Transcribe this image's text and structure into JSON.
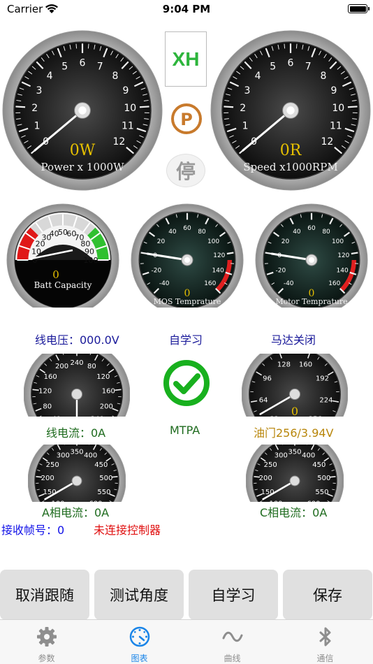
{
  "status_bar": {
    "carrier": "Carrier",
    "time": "9:04 PM"
  },
  "top_row": {
    "power_gauge": {
      "readout": "0W",
      "label": "Power x 1000W",
      "ticks": [
        "0",
        "1",
        "2",
        "3",
        "4",
        "5",
        "6",
        "7",
        "8",
        "9",
        "10",
        "11",
        "12"
      ],
      "value": 0
    },
    "speed_gauge": {
      "readout": "0R",
      "label": "Speed x1000RPM",
      "ticks": [
        "0",
        "1",
        "2",
        "3",
        "4",
        "5",
        "6",
        "7",
        "8",
        "9",
        "10",
        "11",
        "12"
      ],
      "value": 0
    },
    "xh_badge": "XH",
    "park_icon": "P",
    "stop_button": "停"
  },
  "middle_row": {
    "battery_gauge": {
      "readout": "0",
      "label": "Batt Capacity",
      "ticks": [
        "0",
        "10",
        "20",
        "30",
        "40",
        "50",
        "60",
        "70",
        "80",
        "90",
        "100"
      ],
      "value": 0
    },
    "mos_temp_gauge": {
      "readout": "0",
      "unit_glyph": "",
      "label": "MOS Temprature",
      "ticks": [
        "-40",
        "-20",
        "0",
        "20",
        "40",
        "60",
        "80",
        "100",
        "120",
        "140",
        "160"
      ],
      "value": 0
    },
    "motor_temp_gauge": {
      "readout": "0",
      "unit_glyph": "",
      "label": "Motor Temprature",
      "ticks": [
        "-40",
        "-20",
        "0",
        "20",
        "40",
        "60",
        "80",
        "100",
        "120",
        "140",
        "160"
      ],
      "value": 0
    }
  },
  "info": {
    "line_voltage": "线电压：000.0V",
    "self_learn_status": "自学习",
    "motor_status": "马达关闭",
    "line_current": "线电流：0A",
    "mode": "MTPA",
    "throttle": "油门256/3.94V",
    "phase_a_current": "A相电流：0A",
    "phase_c_current": "C相电流：0A",
    "frame_count": "接收帧号：0",
    "connection_status": "未连接控制器"
  },
  "small_gauges": {
    "line_current_ticks": [
      "40",
      "80",
      "120",
      "160",
      "200",
      "240",
      "80",
      "120",
      "160",
      "200",
      "240"
    ],
    "throttle_ticks": [
      "32",
      "64",
      "96",
      "128",
      "160",
      "192",
      "224",
      "256"
    ],
    "throttle_readout": "0",
    "phase_ticks": [
      "100",
      "150",
      "200",
      "250",
      "300",
      "350",
      "400",
      "450",
      "500",
      "550",
      "600"
    ]
  },
  "buttons": {
    "cancel_follow": "取消跟随",
    "test_angle": "测试角度",
    "self_learn": "自学习",
    "save": "保存"
  },
  "tabs": [
    {
      "label": "参数",
      "icon": "gear-icon"
    },
    {
      "label": "图表",
      "icon": "gauge-icon"
    },
    {
      "label": "曲线",
      "icon": "wave-icon"
    },
    {
      "label": "通信",
      "icon": "bluetooth-icon"
    }
  ],
  "colors": {
    "accent": "#1a85e8",
    "xh_green": "#2db53c",
    "park_brown": "#c87a2c",
    "alert_red": "#e01010"
  }
}
